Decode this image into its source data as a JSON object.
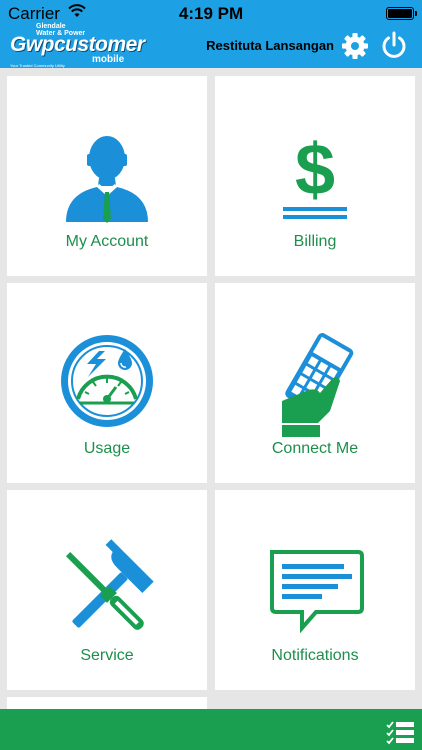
{
  "status_bar": {
    "carrier": "Carrier",
    "time": "4:19 PM"
  },
  "header": {
    "logo": {
      "city": "Glendale",
      "sub": "Water & Power",
      "brand": "Gwpcustomer",
      "mobile": "mobile",
      "tagline": "Your Trusted Community Utility"
    },
    "user_name": "Restituta Lansangan"
  },
  "tiles": [
    {
      "label": "My Account",
      "icon": "person-icon"
    },
    {
      "label": "Billing",
      "icon": "dollar-icon"
    },
    {
      "label": "Usage",
      "icon": "gauge-icon"
    },
    {
      "label": "Connect Me",
      "icon": "phone-hand-icon"
    },
    {
      "label": "Service",
      "icon": "tools-icon"
    },
    {
      "label": "Notifications",
      "icon": "message-icon"
    }
  ],
  "colors": {
    "header": "#1da1e4",
    "accent_green": "#1a9e4f",
    "icon_blue": "#1b8fd8",
    "label_green": "#1d8f4c"
  }
}
